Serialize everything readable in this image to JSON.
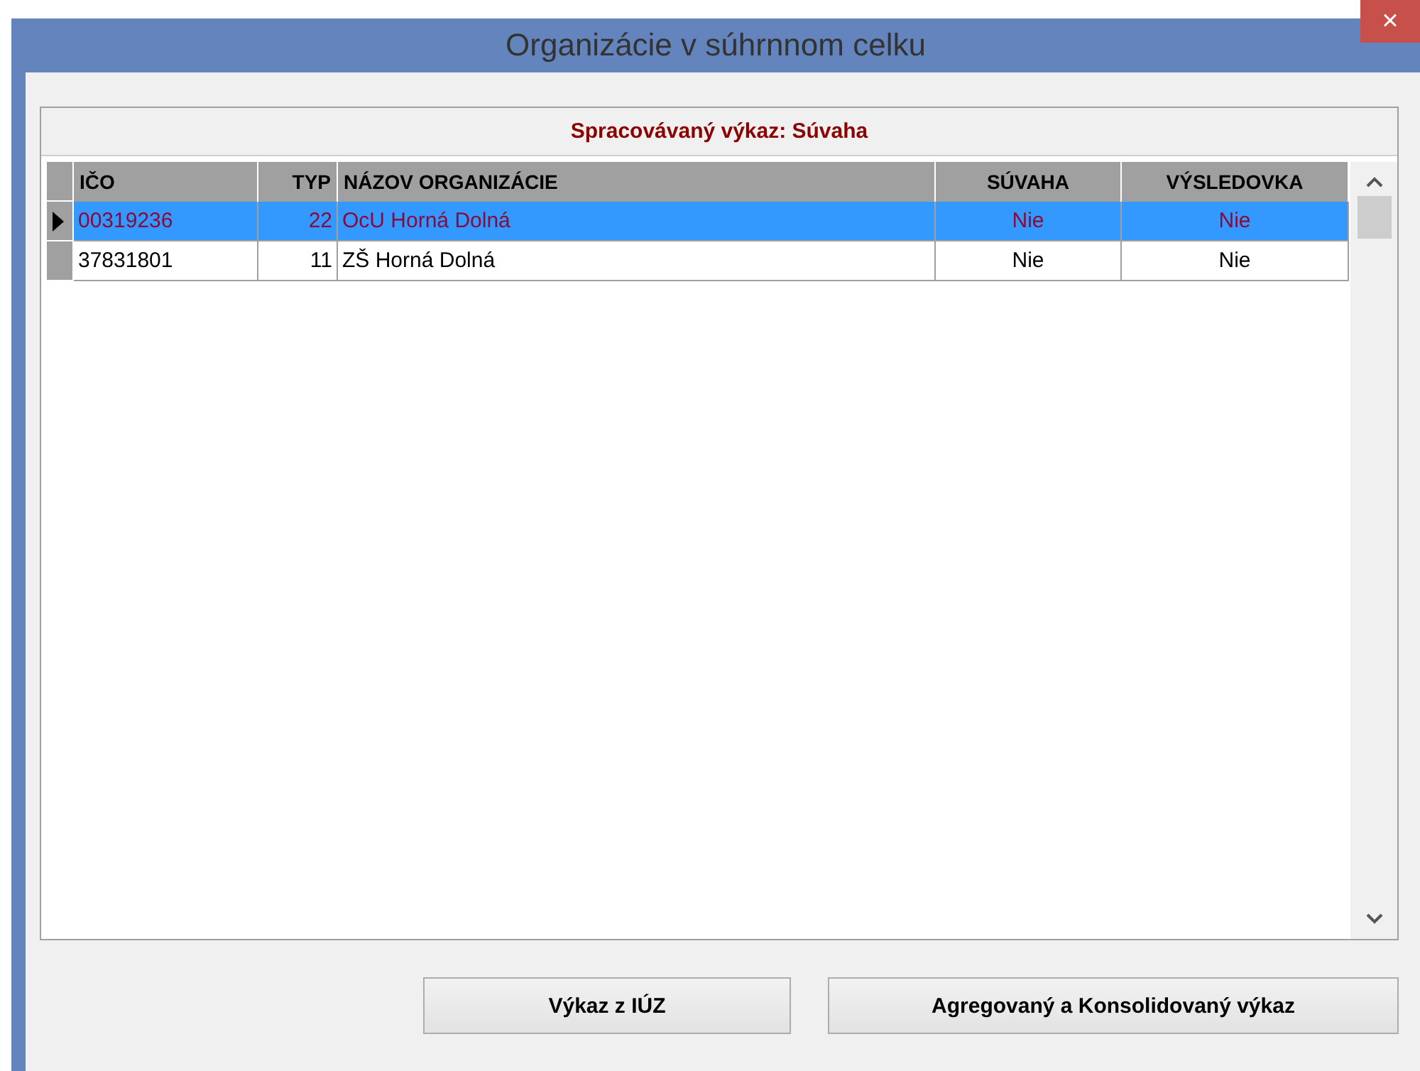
{
  "window": {
    "title": "Organizácie v súhrnnom celku",
    "close": "×"
  },
  "caption": "Spracovávaný výkaz: Súvaha",
  "table": {
    "columns": [
      "IČO",
      "TYP",
      "NÁZOV ORGANIZÁCIE",
      "SÚVAHA",
      "VÝSLEDOVKA"
    ],
    "rows": [
      {
        "selected": true,
        "cells": [
          "00319236",
          "22",
          "OcU Horná Dolná",
          "Nie",
          "Nie"
        ]
      },
      {
        "selected": false,
        "cells": [
          "37831801",
          "11",
          "ZŠ Horná Dolná",
          "Nie",
          "Nie"
        ]
      }
    ]
  },
  "buttons": [
    "Výkaz z IÚZ",
    "Agregovaný a Konsolidovaný výkaz"
  ]
}
